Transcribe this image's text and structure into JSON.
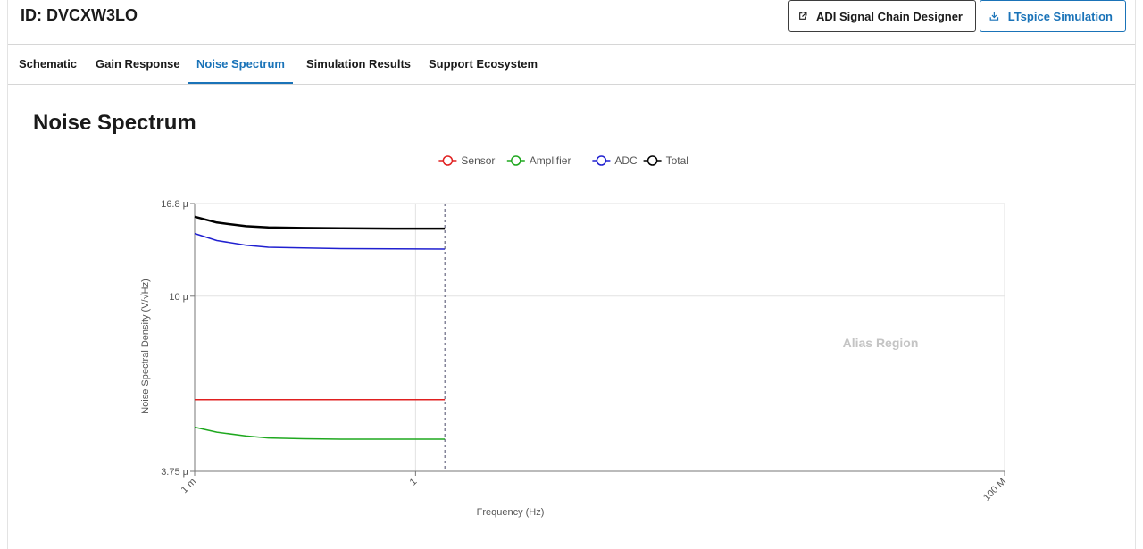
{
  "header": {
    "id_text": "ID: DVCXW3LO",
    "designer_button_label": "ADI Signal Chain Designer",
    "ltspice_button_label": "LTspice Simulation"
  },
  "icons": {
    "designer": "external-link-icon",
    "ltspice": "download-icon"
  },
  "tabs": [
    {
      "label": "Schematic",
      "active": false
    },
    {
      "label": "Gain Response",
      "active": false
    },
    {
      "label": "Noise Spectrum",
      "active": true
    },
    {
      "label": "Simulation Results",
      "active": false
    },
    {
      "label": "Support Ecosystem",
      "active": false
    }
  ],
  "colors": {
    "accent": "#1a73b8",
    "sensor": "#e02020",
    "amplifier": "#1fa81f",
    "adc": "#2020d0",
    "total": "#000000"
  },
  "section": {
    "title": "Noise Spectrum"
  },
  "chart_data": {
    "type": "line",
    "title": "",
    "xlabel": "Frequency (Hz)",
    "ylabel": "Noise Spectral Density (V/√Hz)",
    "xscale": "log",
    "yscale": "log",
    "xlim": [
      0.001,
      100000000
    ],
    "ylim": [
      3.75e-06,
      1.68e-05
    ],
    "x_ticks": [
      {
        "value": 0.001,
        "label": "1 m"
      },
      {
        "value": 1,
        "label": "1"
      },
      {
        "value": 100000000,
        "label": "100 M"
      }
    ],
    "y_ticks": [
      {
        "value": 3.75e-06,
        "label": "3.75 µ"
      },
      {
        "value": 1e-05,
        "label": "10 µ"
      },
      {
        "value": 1.68e-05,
        "label": "16.8 µ"
      }
    ],
    "grid": true,
    "legend": "top-center",
    "nyquist_marker_x": 2.5,
    "annotation": "Alias Region",
    "series": [
      {
        "name": "Sensor",
        "color": "#e02020",
        "stroke": 1.5,
        "x": [
          0.001,
          2.5
        ],
        "y": [
          5.6e-06,
          5.6e-06
        ]
      },
      {
        "name": "Amplifier",
        "color": "#1fa81f",
        "stroke": 1.5,
        "x": [
          0.001,
          0.002,
          0.005,
          0.01,
          0.03,
          0.1,
          0.5,
          2.5
        ],
        "y": [
          4.8e-06,
          4.67e-06,
          4.57e-06,
          4.52e-06,
          4.5e-06,
          4.49e-06,
          4.49e-06,
          4.49e-06
        ]
      },
      {
        "name": "ADC",
        "color": "#2020d0",
        "stroke": 1.5,
        "x": [
          0.001,
          0.002,
          0.005,
          0.01,
          0.03,
          0.1,
          0.5,
          2.5
        ],
        "y": [
          1.42e-05,
          1.365e-05,
          1.33e-05,
          1.315e-05,
          1.31e-05,
          1.305e-05,
          1.303e-05,
          1.302e-05
        ]
      },
      {
        "name": "Total",
        "color": "#000000",
        "stroke": 2.5,
        "x": [
          0.001,
          0.002,
          0.005,
          0.01,
          0.03,
          0.1,
          0.5,
          2.5
        ],
        "y": [
          1.56e-05,
          1.51e-05,
          1.48e-05,
          1.47e-05,
          1.465e-05,
          1.462e-05,
          1.46e-05,
          1.46e-05
        ]
      }
    ]
  }
}
